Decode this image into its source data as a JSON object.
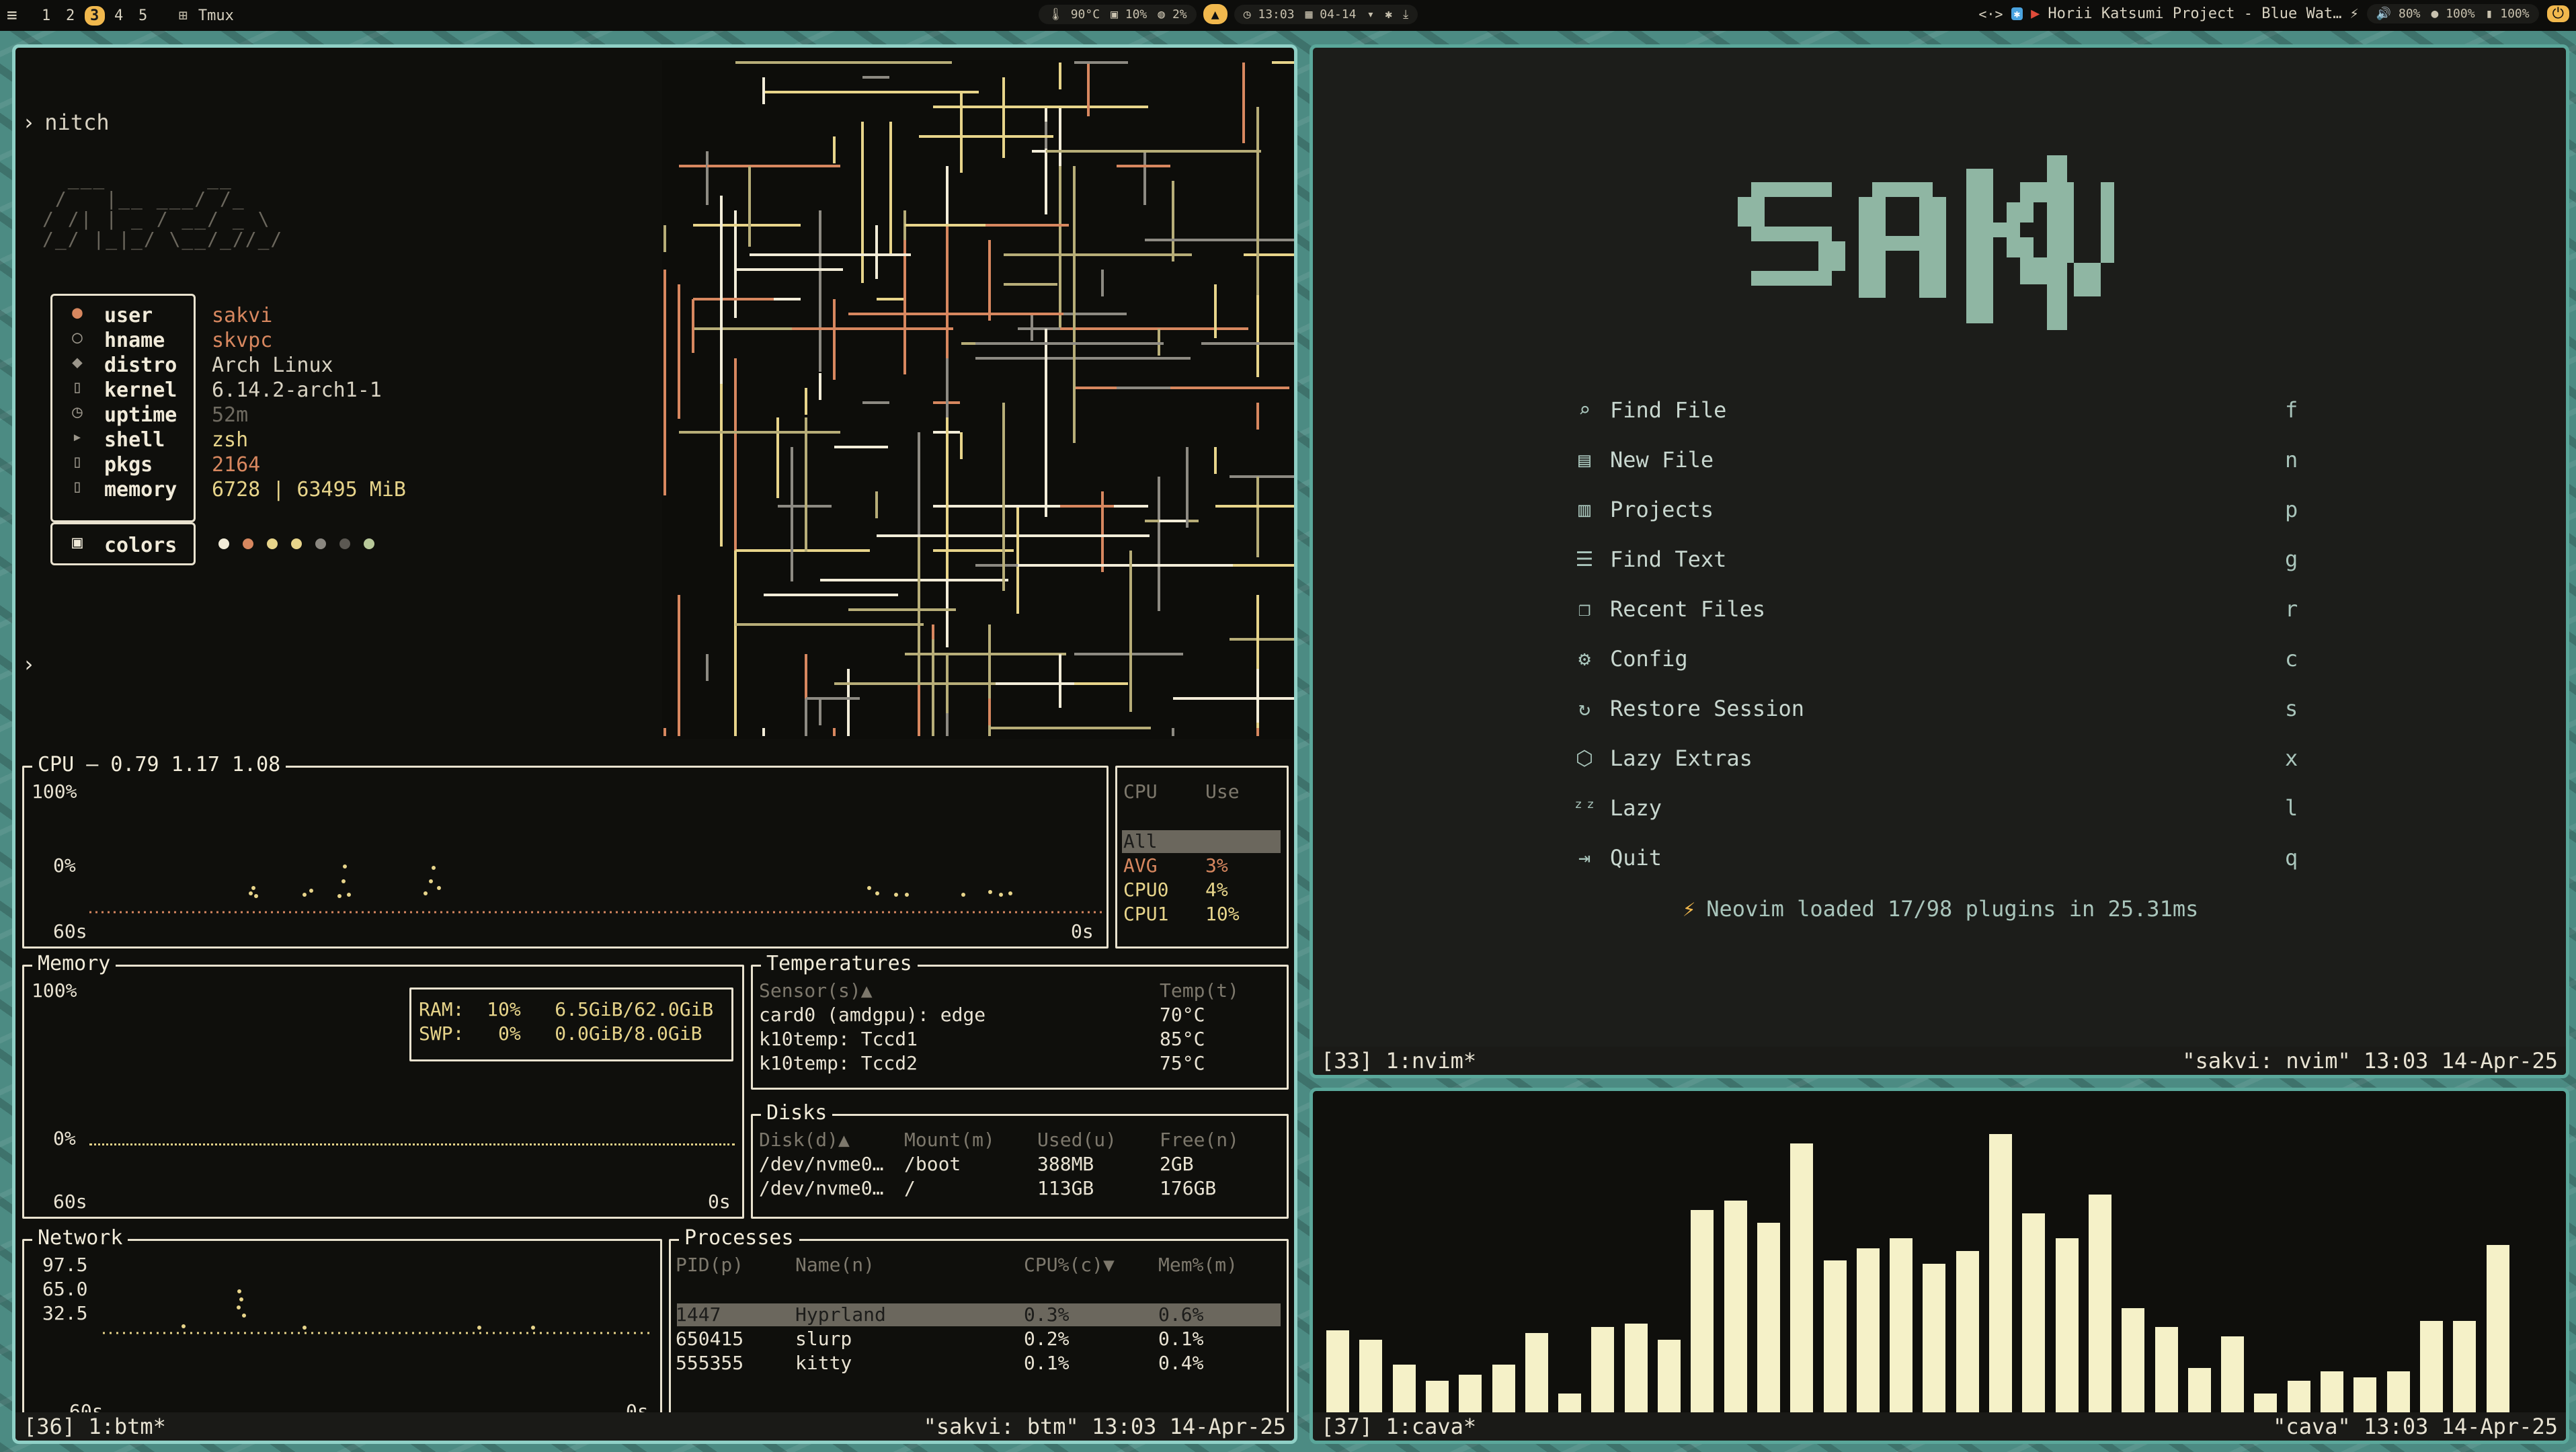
{
  "topbar": {
    "menu_icon": "menu-icon",
    "workspaces": [
      "1",
      "2",
      "3",
      "4",
      "5"
    ],
    "active_workspace": "3",
    "app_name": "Tmux",
    "temp": "90°C",
    "ram": "10%",
    "cpu": "2%",
    "time": "13:03",
    "date": "04-14",
    "media": "Horii Katsumi Project - Blue Wat…",
    "volume": "80%",
    "brightness": "100%",
    "battery": "100%"
  },
  "fetch": {
    "command": "nitch",
    "ascii": "  ___        __\n /   |__ ___/ /_\n/ /| | _ / __/ _ \\\n/_/ |_|_/ \\__/_//_/",
    "rows": [
      {
        "icon": "user-icon",
        "key": "user",
        "value": "sakvi",
        "accent": "orange"
      },
      {
        "icon": "host-icon",
        "key": "hname",
        "value": "skvpc",
        "accent": "orange"
      },
      {
        "icon": "distro-icon",
        "key": "distro",
        "value": "Arch Linux",
        "accent": "fg"
      },
      {
        "icon": "kernel-icon",
        "key": "kernel",
        "value": "6.14.2-arch1-1",
        "accent": "fg"
      },
      {
        "icon": "clock-icon",
        "key": "uptime",
        "value": "52m",
        "accent": "dim"
      },
      {
        "icon": "terminal-icon",
        "key": "shell",
        "value": "zsh",
        "accent": "yellow"
      },
      {
        "icon": "package-icon",
        "key": "pkgs",
        "value": "2164",
        "accent": "orange"
      },
      {
        "icon": "memory-icon",
        "key": "memory",
        "value": "6728 | 63495 MiB",
        "accent": "yellow"
      }
    ],
    "colors_label": "colors",
    "palette": [
      "#f2ecd8",
      "#d7875f",
      "#e7d48a",
      "#e7d48a",
      "#8a8780",
      "#5b5852",
      "#b8c99a"
    ]
  },
  "btm": {
    "cpu": {
      "title": "CPU — 0.79 1.17 1.08",
      "y_top": "100%",
      "y_bottom": "0%",
      "x_left": "60s",
      "x_right": "0s",
      "table_headers": [
        "CPU",
        "Use"
      ],
      "rows": [
        {
          "name": "All",
          "use": ""
        },
        {
          "name": "AVG",
          "use": "3%"
        },
        {
          "name": "CPU0",
          "use": "4%"
        },
        {
          "name": "CPU1",
          "use": "10%"
        }
      ]
    },
    "memory": {
      "title": "Memory",
      "y_top": "100%",
      "y_bottom": "0%",
      "x_left": "60s",
      "x_right": "0s",
      "ram": "RAM:  10%   6.5GiB/62.0GiB",
      "swp": "SWP:   0%   0.0GiB/8.0GiB"
    },
    "temps": {
      "title": "Temperatures",
      "headers": [
        "Sensor(s)▲",
        "Temp(t)"
      ],
      "rows": [
        {
          "sensor": "card0 (amdgpu): edge",
          "temp": "70°C"
        },
        {
          "sensor": "k10temp: Tccd1",
          "temp": "85°C"
        },
        {
          "sensor": "k10temp: Tccd2",
          "temp": "75°C"
        }
      ]
    },
    "disks": {
      "title": "Disks",
      "headers": [
        "Disk(d)▲",
        "Mount(m)",
        "Used(u)",
        "Free(n)"
      ],
      "rows": [
        {
          "disk": "/dev/nvme0…",
          "mount": "/boot",
          "used": "388MB",
          "free": "2GB"
        },
        {
          "disk": "/dev/nvme0…",
          "mount": "/",
          "used": "113GB",
          "free": "176GB"
        }
      ]
    },
    "network": {
      "title": "Network",
      "ticks": [
        "97.5",
        "65.0",
        "32.5"
      ],
      "x_left": "60s",
      "x_right": "0s"
    },
    "processes": {
      "title": "Processes",
      "headers": [
        "PID(p)",
        "Name(n)",
        "CPU%(c)▼",
        "Mem%(m)"
      ],
      "rows": [
        {
          "pid": "1447",
          "name": "Hyprland",
          "cpu": "0.3%",
          "mem": "0.6%"
        },
        {
          "pid": "650415",
          "name": "slurp",
          "cpu": "0.2%",
          "mem": "0.1%"
        },
        {
          "pid": "555355",
          "name": "kitty",
          "cpu": "0.1%",
          "mem": "0.4%"
        }
      ]
    },
    "status_left": "[36] 1:btm*",
    "status_right": "\"sakvi: btm\" 13:03 14-Apr-25"
  },
  "nvim": {
    "logo": "SAKVI",
    "menu": [
      {
        "icon": "search-icon",
        "label": "Find File",
        "key": "f"
      },
      {
        "icon": "file-icon",
        "label": "New File",
        "key": "n"
      },
      {
        "icon": "projects-icon",
        "label": "Projects",
        "key": "p"
      },
      {
        "icon": "text-search-icon",
        "label": "Find Text",
        "key": "g"
      },
      {
        "icon": "recent-files-icon",
        "label": "Recent Files",
        "key": "r"
      },
      {
        "icon": "gear-icon",
        "label": "Config",
        "key": "c"
      },
      {
        "icon": "restore-icon",
        "label": "Restore Session",
        "key": "s"
      },
      {
        "icon": "box-icon",
        "label": "Lazy Extras",
        "key": "x"
      },
      {
        "icon": "sleep-icon",
        "label": "Lazy",
        "key": "l"
      },
      {
        "icon": "exit-icon",
        "label": "Quit",
        "key": "q"
      }
    ],
    "footer": "Neovim loaded 17/98 plugins in 25.31ms",
    "status_left": "[33] 1:nvim*",
    "status_right": "\"sakvi: nvim\" 13:03 14-Apr-25"
  },
  "cava": {
    "levels": [
      0.26,
      0.23,
      0.15,
      0.1,
      0.12,
      0.15,
      0.25,
      0.06,
      0.27,
      0.28,
      0.23,
      0.64,
      0.67,
      0.6,
      0.85,
      0.48,
      0.52,
      0.55,
      0.47,
      0.51,
      0.88,
      0.63,
      0.55,
      0.69,
      0.33,
      0.27,
      0.14,
      0.24,
      0.06,
      0.1,
      0.13,
      0.11,
      0.13,
      0.29,
      0.29,
      0.53
    ],
    "status_left": "[37] 1:cava*",
    "status_right": "\"cava\" 13:03 14-Apr-25"
  }
}
